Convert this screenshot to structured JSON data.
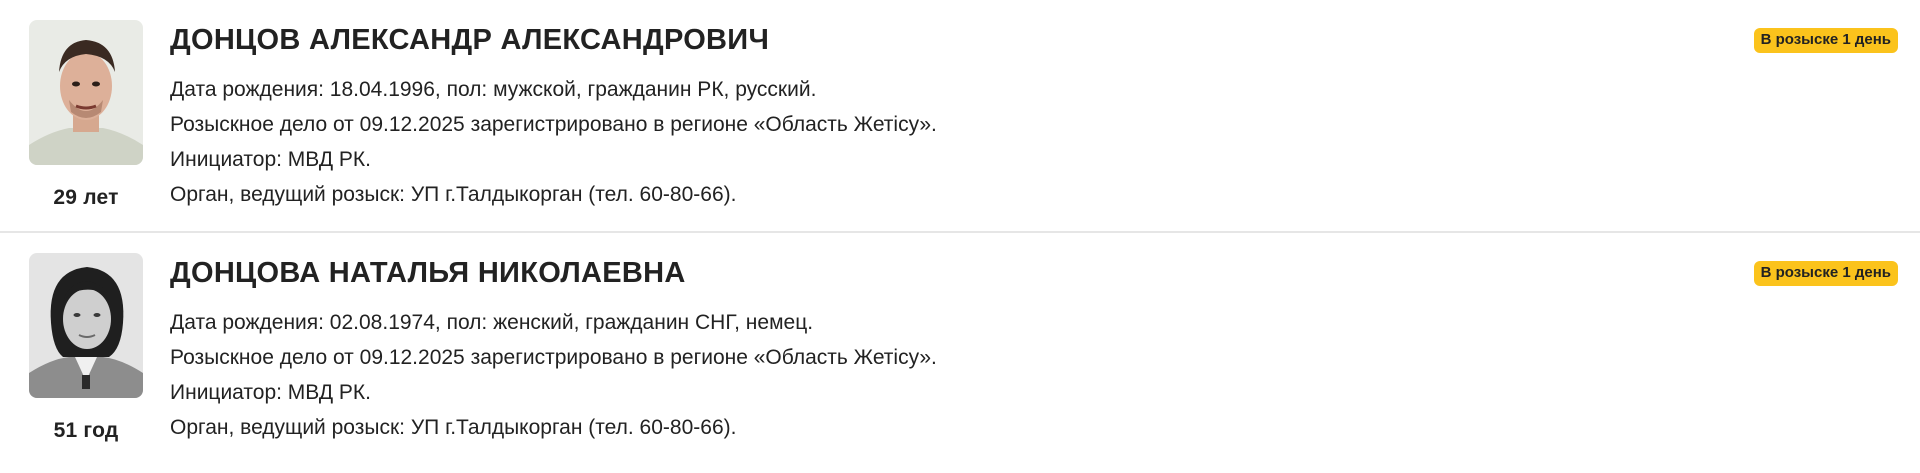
{
  "persons": [
    {
      "name": "ДОНЦОВ АЛЕКСАНДР АЛЕКСАНДРОВИЧ",
      "age": "29 лет",
      "badge": "В розыске 1 день",
      "lines": [
        "Дата рождения: 18.04.1996, пол: мужской, гражданин РК, русский.",
        "Розыскное дело от 09.12.2025 зарегистрировано в регионе «Область Жетісу».",
        "Инициатор: МВД РК.",
        "Орган, ведущий розыск: УП г.Талдыкорган (тел. 60-80-66)."
      ]
    },
    {
      "name": "ДОНЦОВА НАТАЛЬЯ НИКОЛАЕВНА",
      "age": "51 год",
      "badge": "В розыске 1 день",
      "lines": [
        "Дата рождения: 02.08.1974, пол: женский, гражданин СНГ, немец.",
        "Розыскное дело от 09.12.2025 зарегистрировано в регионе «Область Жетісу».",
        "Инициатор: МВД РК.",
        "Орган, ведущий розыск: УП г.Талдыкорган (тел. 60-80-66)."
      ]
    }
  ],
  "colors": {
    "badge_bg": "#fbc31c",
    "divider": "#e6e6e6",
    "text": "#222222"
  }
}
